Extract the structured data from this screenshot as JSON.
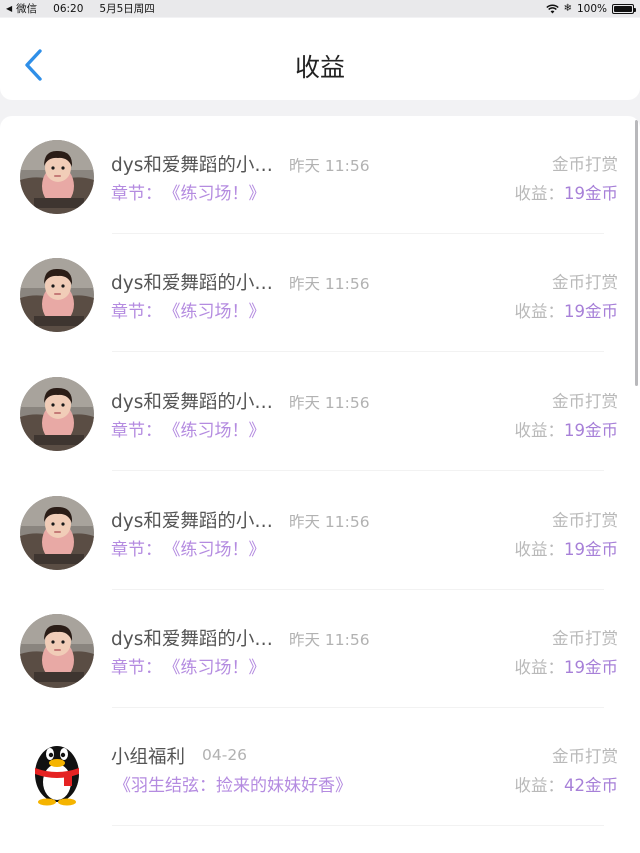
{
  "status_bar": {
    "back_app": "微信",
    "time": "06:20",
    "date": "5月5日周四",
    "battery": "100%"
  },
  "header": {
    "title": "收益"
  },
  "rows": [
    {
      "name": "dys和爱舞蹈的小…",
      "time": "昨天 11:56",
      "chapter_label": "章节：",
      "chapter_title": "《练习场！》",
      "type": "金币打赏",
      "earn_label": "收益：",
      "earn_amount": "19金币",
      "avatar": "girl-photo"
    },
    {
      "name": "dys和爱舞蹈的小…",
      "time": "昨天 11:56",
      "chapter_label": "章节：",
      "chapter_title": "《练习场！》",
      "type": "金币打赏",
      "earn_label": "收益：",
      "earn_amount": "19金币",
      "avatar": "girl-photo"
    },
    {
      "name": "dys和爱舞蹈的小…",
      "time": "昨天 11:56",
      "chapter_label": "章节：",
      "chapter_title": "《练习场！》",
      "type": "金币打赏",
      "earn_label": "收益：",
      "earn_amount": "19金币",
      "avatar": "girl-photo"
    },
    {
      "name": "dys和爱舞蹈的小…",
      "time": "昨天 11:56",
      "chapter_label": "章节：",
      "chapter_title": "《练习场！》",
      "type": "金币打赏",
      "earn_label": "收益：",
      "earn_amount": "19金币",
      "avatar": "girl-photo"
    },
    {
      "name": "dys和爱舞蹈的小…",
      "time": "昨天 11:56",
      "chapter_label": "章节：",
      "chapter_title": "《练习场！》",
      "type": "金币打赏",
      "earn_label": "收益：",
      "earn_amount": "19金币",
      "avatar": "girl-photo"
    },
    {
      "name": "小组福利",
      "time": "04-26",
      "chapter_label": "",
      "chapter_title": "《羽生结弦：捡来的妹妹好香》",
      "type": "金币打赏",
      "earn_label": "收益：",
      "earn_amount": "42金币",
      "avatar": "penguin"
    }
  ],
  "colors": {
    "accent_purple": "#b48be0",
    "back_blue": "#2f8fe8",
    "muted_gray": "#b9b9b9"
  }
}
